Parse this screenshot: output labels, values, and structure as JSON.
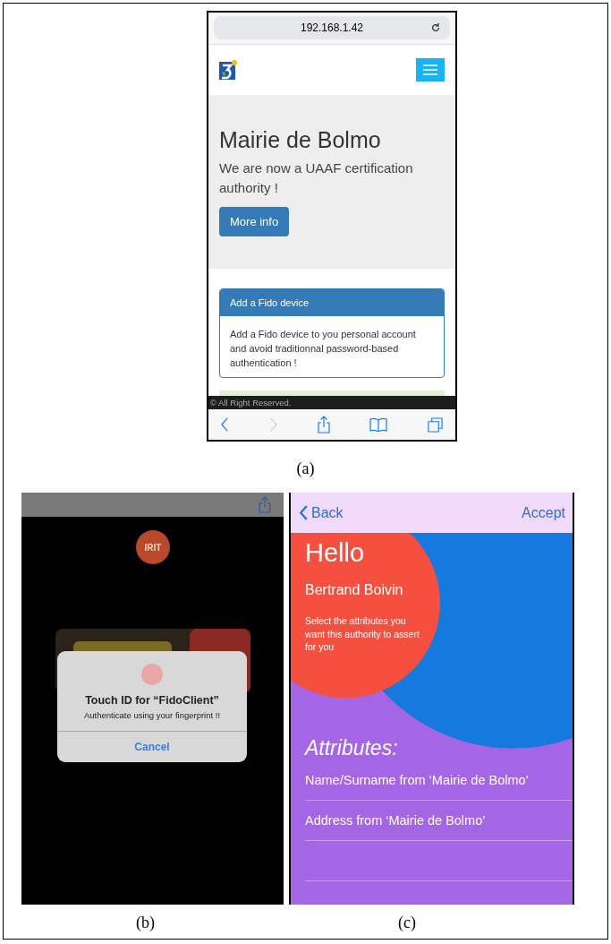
{
  "browser": {
    "address": "192.168.1.42",
    "site_title": "Mairie de Bolmo",
    "lead": "We are now a UAAF certification authority !",
    "button": "More info",
    "card": {
      "heading": "Add a Fido device",
      "body": "Add a Fido device to you personal account and avoid traditionnal password-based authentication !"
    },
    "footer": "© All Right Reserved.",
    "toolbar": [
      {
        "kind": "back",
        "disabled": false
      },
      {
        "kind": "forward",
        "disabled": true
      },
      {
        "kind": "share",
        "disabled": false
      },
      {
        "kind": "bookmarks",
        "disabled": false
      },
      {
        "kind": "tabs",
        "disabled": false
      }
    ]
  },
  "caption_a": "(a)",
  "touch_id": {
    "logo": "IRIT",
    "title": "Touch ID for “FidoClient”",
    "message": "Authenticate using your fingerprint !!",
    "button": "Cancel"
  },
  "consent": {
    "back": "Back",
    "accept": "Accept",
    "greeting": "Hello",
    "user": "Bertrand Boivin",
    "instruction": "Select the attributes you want this authority to assert for you",
    "attributes_heading": "Attributes:",
    "attributes": [
      {
        "label": "Name/Surname from ‘Mairie de Bolmo’"
      },
      {
        "label": "Address from ‘Mairie de Bolmo’"
      }
    ]
  },
  "caption_b": "(b)",
  "caption_c": "(c)"
}
